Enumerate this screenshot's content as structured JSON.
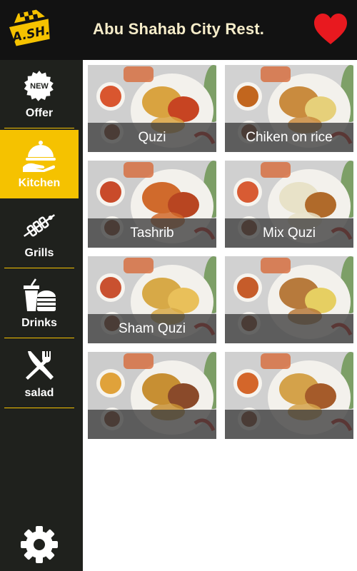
{
  "header": {
    "logo_text": "A.SH.",
    "title": "Abu Shahab City Rest."
  },
  "sidebar": {
    "items": [
      {
        "label": "Offer",
        "icon": "new-badge-icon",
        "badge": "NEW",
        "active": false
      },
      {
        "label": "Kitchen",
        "icon": "serving-cloche-icon",
        "active": true
      },
      {
        "label": "Grills",
        "icon": "skewer-icon",
        "active": false
      },
      {
        "label": "Drinks",
        "icon": "drink-burger-icon",
        "active": false
      },
      {
        "label": "salad",
        "icon": "fork-knife-icon",
        "active": false
      }
    ],
    "settings_icon": "gear-icon"
  },
  "menu": {
    "items": [
      {
        "name": "Quzi"
      },
      {
        "name": "Chiken on rice"
      },
      {
        "name": "Tashrib"
      },
      {
        "name": "Mix Quzi"
      },
      {
        "name": "Sham Quzi"
      },
      {
        "name": ""
      },
      {
        "name": ""
      },
      {
        "name": ""
      }
    ]
  },
  "colors": {
    "header_bg": "#121212",
    "sidebar_bg": "#1f211d",
    "accent": "#f5c200",
    "heart": "#e8191f",
    "title_text": "#f6ecc9"
  }
}
